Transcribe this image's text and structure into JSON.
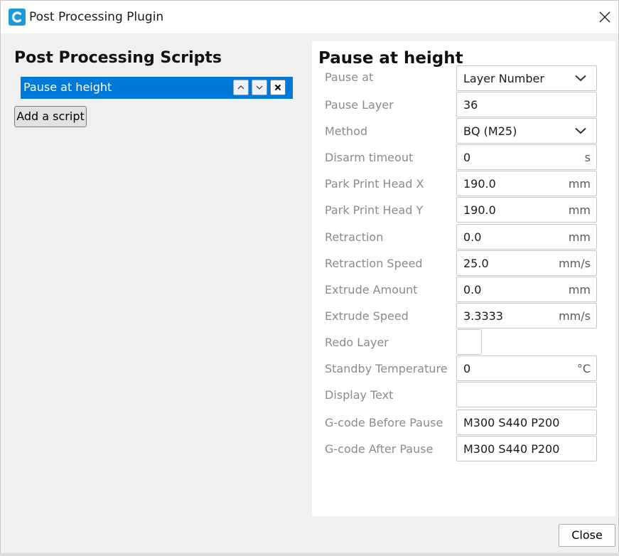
{
  "window": {
    "title": "Post Processing Plugin",
    "close_label": "Close"
  },
  "colors": {
    "selection": "#0078d7",
    "app_icon": "#1a9bd7"
  },
  "icons": {
    "app": "cura-logo-icon",
    "window_close": "close-icon",
    "move_up": "chevron-up-icon",
    "move_down": "chevron-down-icon",
    "remove": "close-icon",
    "dropdown": "chevron-down-icon"
  },
  "scripts_panel": {
    "title": "Post Processing Scripts",
    "scripts": [
      {
        "label": "Pause at height",
        "selected": true
      }
    ],
    "add_button": "Add a script"
  },
  "settings_panel": {
    "title": "Pause at height",
    "rows": [
      {
        "label": "Pause at",
        "type": "select",
        "value": "Layer Number"
      },
      {
        "label": "Pause Layer",
        "type": "text",
        "value": "36",
        "unit": ""
      },
      {
        "label": "Method",
        "type": "select",
        "value": "BQ (M25)"
      },
      {
        "label": "Disarm timeout",
        "type": "text",
        "value": "0",
        "unit": "s"
      },
      {
        "label": "Park Print Head X",
        "type": "text",
        "value": "190.0",
        "unit": "mm"
      },
      {
        "label": "Park Print Head Y",
        "type": "text",
        "value": "190.0",
        "unit": "mm"
      },
      {
        "label": "Retraction",
        "type": "text",
        "value": "0.0",
        "unit": "mm"
      },
      {
        "label": "Retraction Speed",
        "type": "text",
        "value": "25.0",
        "unit": "mm/s"
      },
      {
        "label": "Extrude Amount",
        "type": "text",
        "value": "0.0",
        "unit": "mm"
      },
      {
        "label": "Extrude Speed",
        "type": "text",
        "value": "3.3333",
        "unit": "mm/s"
      },
      {
        "label": "Redo Layer",
        "type": "checkbox",
        "checked": false
      },
      {
        "label": "Standby Temperature",
        "type": "text",
        "value": "0",
        "unit": "°C"
      },
      {
        "label": "Display Text",
        "type": "text",
        "value": "",
        "unit": ""
      },
      {
        "label": "G-code Before Pause",
        "type": "text",
        "value": "M300 S440 P200",
        "unit": ""
      },
      {
        "label": "G-code After Pause",
        "type": "text",
        "value": "M300 S440 P200",
        "unit": ""
      }
    ]
  }
}
